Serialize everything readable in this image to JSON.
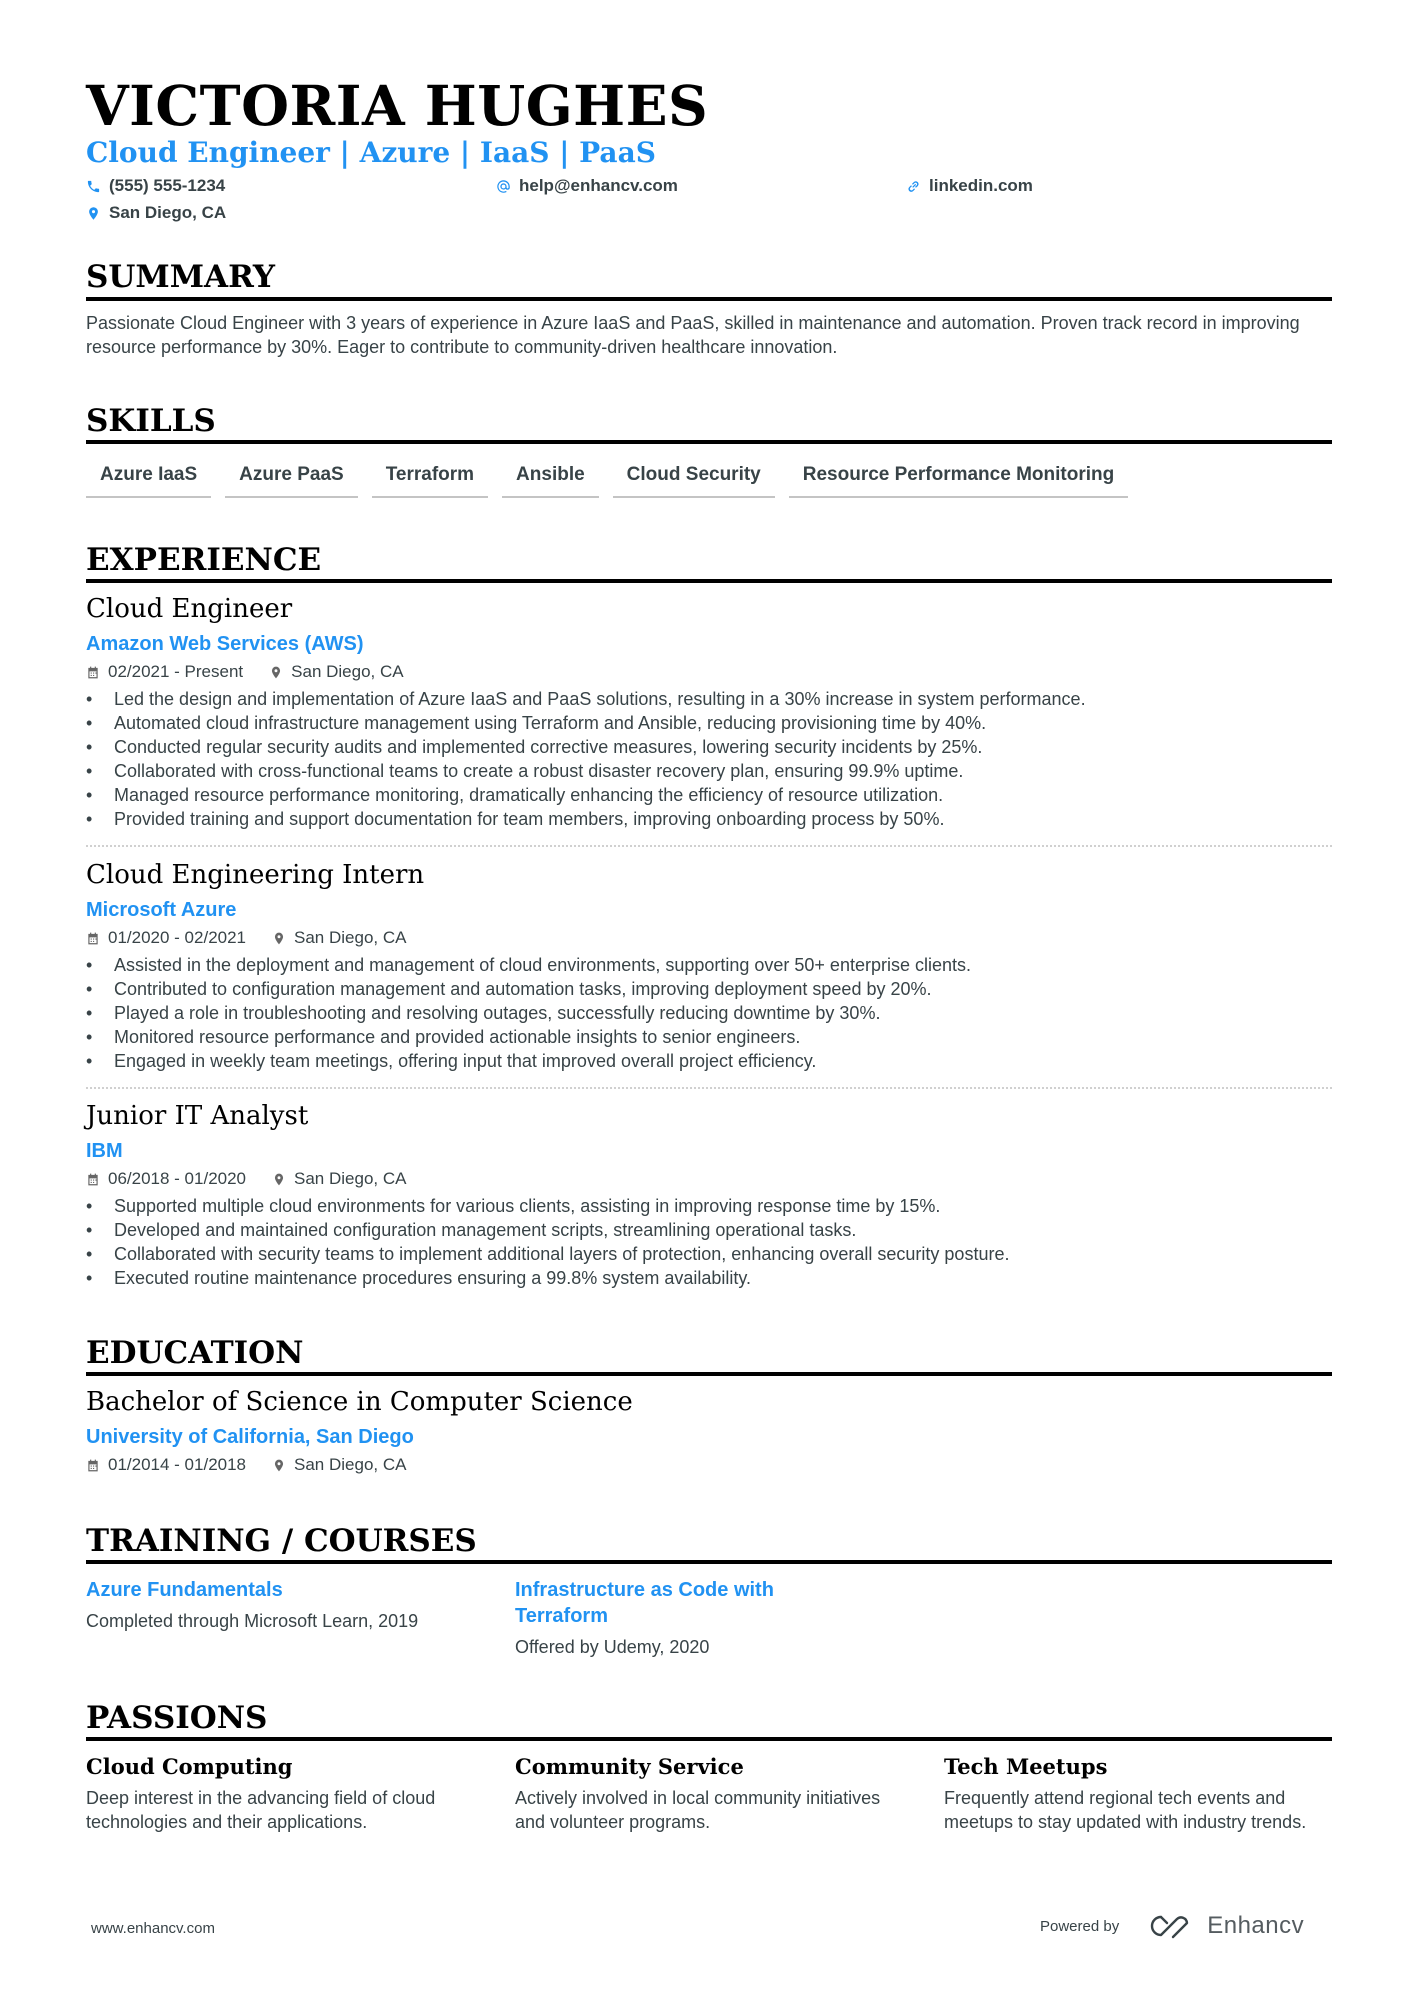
{
  "header": {
    "name": "VICTORIA HUGHES",
    "subtitle": "Cloud Engineer | Azure | IaaS | PaaS",
    "contacts": {
      "phone": "(555) 555-1234",
      "email": "help@enhancv.com",
      "link": "linkedin.com",
      "location": "San Diego, CA"
    }
  },
  "summary": {
    "title": "SUMMARY",
    "text": "Passionate Cloud Engineer with 3 years of experience in Azure IaaS and PaaS, skilled in maintenance and automation. Proven track record in improving resource performance by 30%. Eager to contribute to community-driven healthcare innovation."
  },
  "skills": {
    "title": "SKILLS",
    "items": [
      "Azure IaaS",
      "Azure PaaS",
      "Terraform",
      "Ansible",
      "Cloud Security",
      "Resource Performance Monitoring"
    ]
  },
  "experience": {
    "title": "EXPERIENCE",
    "jobs": [
      {
        "title": "Cloud Engineer",
        "company": "Amazon Web Services (AWS)",
        "dates": "02/2021 - Present",
        "location": "San Diego, CA",
        "bullets": [
          "Led the design and implementation of Azure IaaS and PaaS solutions, resulting in a 30% increase in system performance.",
          "Automated cloud infrastructure management using Terraform and Ansible, reducing provisioning time by 40%.",
          "Conducted regular security audits and implemented corrective measures, lowering security incidents by 25%.",
          "Collaborated with cross-functional teams to create a robust disaster recovery plan, ensuring 99.9% uptime.",
          "Managed resource performance monitoring, dramatically enhancing the efficiency of resource utilization.",
          "Provided training and support documentation for team members, improving onboarding process by 50%."
        ]
      },
      {
        "title": "Cloud Engineering Intern",
        "company": "Microsoft Azure",
        "dates": "01/2020 - 02/2021",
        "location": "San Diego, CA",
        "bullets": [
          "Assisted in the deployment and management of cloud environments, supporting over 50+ enterprise clients.",
          "Contributed to configuration management and automation tasks, improving deployment speed by 20%.",
          "Played a role in troubleshooting and resolving outages, successfully reducing downtime by 30%.",
          "Monitored resource performance and provided actionable insights to senior engineers.",
          "Engaged in weekly team meetings, offering input that improved overall project efficiency."
        ]
      },
      {
        "title": "Junior IT Analyst",
        "company": "IBM",
        "dates": "06/2018 - 01/2020",
        "location": "San Diego, CA",
        "bullets": [
          "Supported multiple cloud environments for various clients, assisting in improving response time by 15%.",
          "Developed and maintained configuration management scripts, streamlining operational tasks.",
          "Collaborated with security teams to implement additional layers of protection, enhancing overall security posture.",
          "Executed routine maintenance procedures ensuring a 99.8% system availability."
        ]
      }
    ]
  },
  "education": {
    "title": "EDUCATION",
    "degree": "Bachelor of Science in Computer Science",
    "school": "University of California, San Diego",
    "dates": "01/2014 - 01/2018",
    "location": "San Diego, CA"
  },
  "training": {
    "title": "TRAINING / COURSES",
    "courses": [
      {
        "title": "Azure Fundamentals",
        "desc": "Completed through Microsoft Learn, 2019"
      },
      {
        "title": "Infrastructure as Code with Terraform",
        "desc": "Offered by Udemy, 2020"
      }
    ]
  },
  "passions": {
    "title": "PASSIONS",
    "items": [
      {
        "title": "Cloud Computing",
        "desc": "Deep interest in the advancing field of cloud technologies and their applications."
      },
      {
        "title": "Community Service",
        "desc": "Actively involved in local community initiatives and volunteer programs."
      },
      {
        "title": "Tech Meetups",
        "desc": "Frequently attend regional tech events and meetups to stay updated with industry trends."
      }
    ]
  },
  "footer": {
    "website": "www.enhancv.com",
    "powered_by": "Powered by",
    "brand": "Enhancv"
  },
  "colors": {
    "accent": "#2192f2",
    "text": "#384347",
    "heading": "#000000"
  }
}
